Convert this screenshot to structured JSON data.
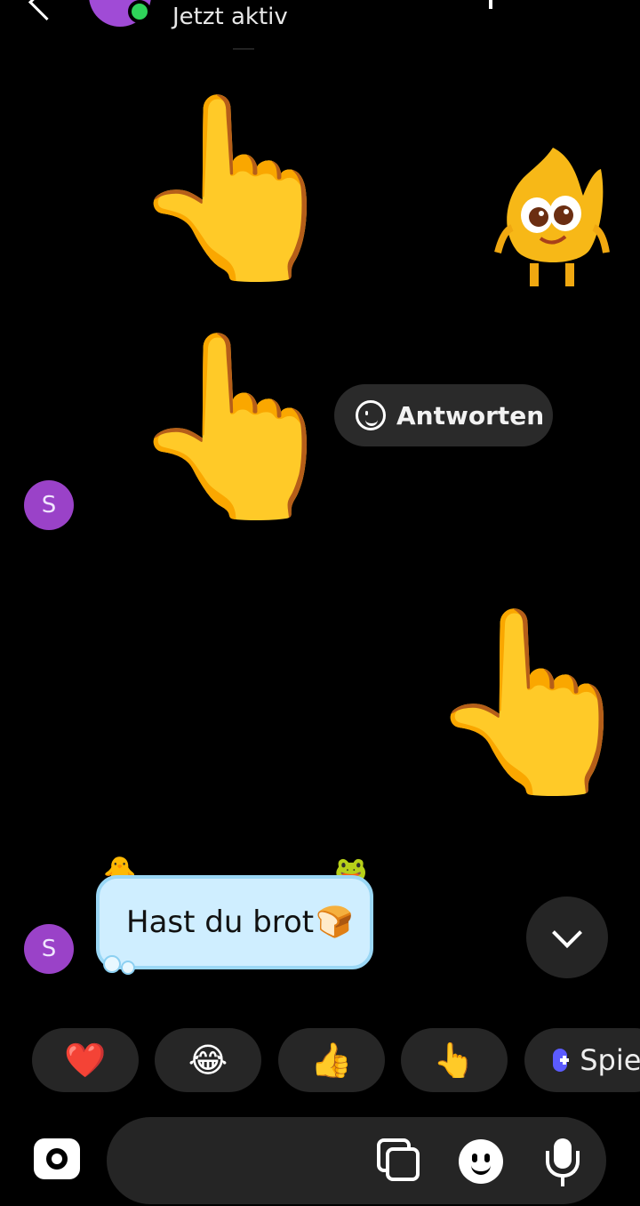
{
  "header": {
    "status": "Jetzt aktiv"
  },
  "stickers": {
    "hand": "👆"
  },
  "reply_pill": {
    "label": "Antworten"
  },
  "contact": {
    "initial": "S"
  },
  "message": {
    "text": "Hast du brot",
    "emoji": "🍞",
    "deco_left": "🐥",
    "deco_right": "🐸"
  },
  "quick_reactions": [
    "❤️",
    "😂",
    "👍",
    "👆"
  ],
  "game_chip": {
    "label": "Spiele"
  },
  "colors": {
    "bubble": "#cfeeff",
    "online": "#2fd35a",
    "avatar": "#9a42c8"
  }
}
